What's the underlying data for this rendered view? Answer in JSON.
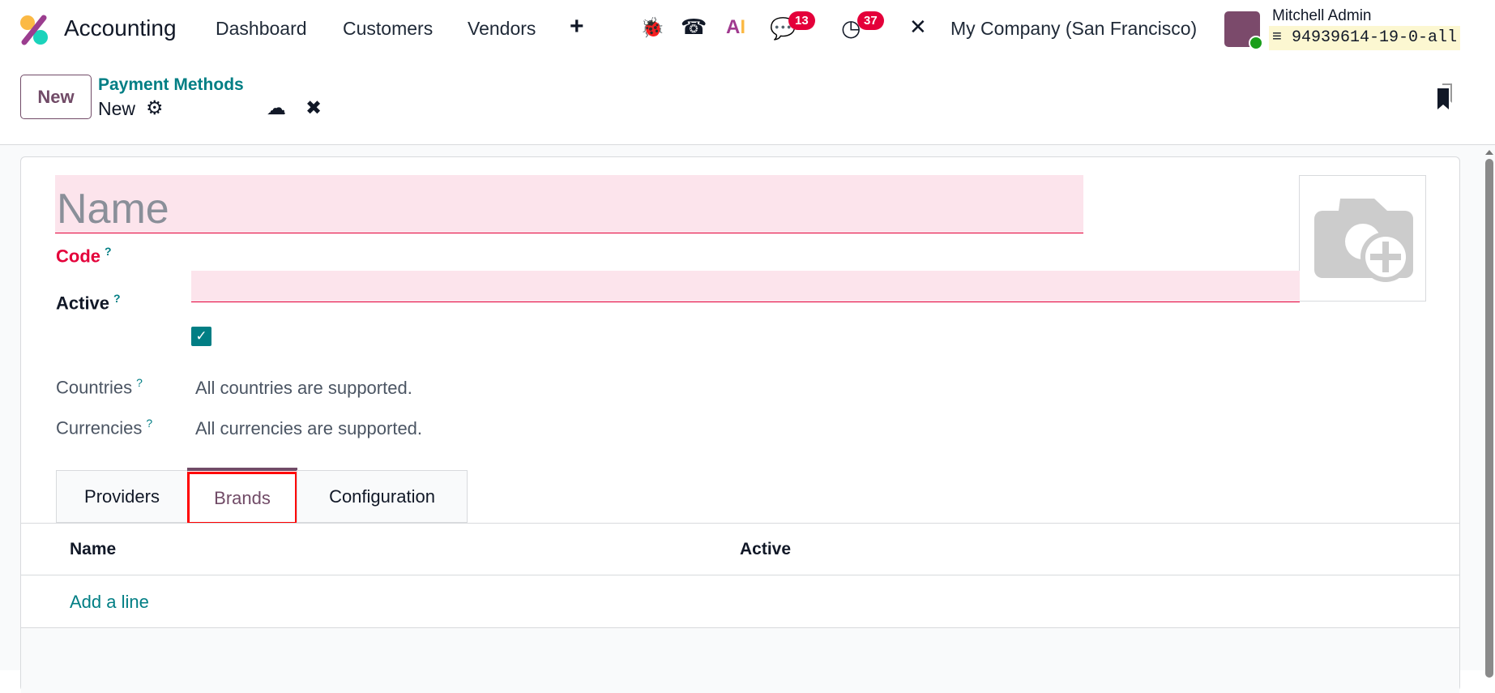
{
  "app": {
    "name": "Accounting",
    "menu": [
      "Dashboard",
      "Customers",
      "Vendors"
    ]
  },
  "systray": {
    "messages_count": "13",
    "activities_count": "37",
    "company": "My Company (San Francisco)",
    "user": "Mitchell Admin",
    "database": "94939614-19-0-all"
  },
  "control_panel": {
    "new_label": "New",
    "breadcrumb_parent": "Payment Methods",
    "breadcrumb_current": "New"
  },
  "form": {
    "name_placeholder": "Name",
    "code_label": "Code",
    "active_label": "Active",
    "active": true,
    "countries_label": "Countries",
    "countries_value": "All countries are supported.",
    "currencies_label": "Currencies",
    "currencies_value": "All currencies are supported.",
    "help_mark": "?"
  },
  "tabs": [
    {
      "label": "Providers"
    },
    {
      "label": "Brands",
      "active": true
    },
    {
      "label": "Configuration"
    }
  ],
  "table": {
    "columns": [
      "Name",
      "Active"
    ],
    "add_line": "Add a line"
  },
  "colors": {
    "brand": "#714b67",
    "link": "#017e84",
    "required": "#e4003a",
    "badge": "#e4003a"
  }
}
